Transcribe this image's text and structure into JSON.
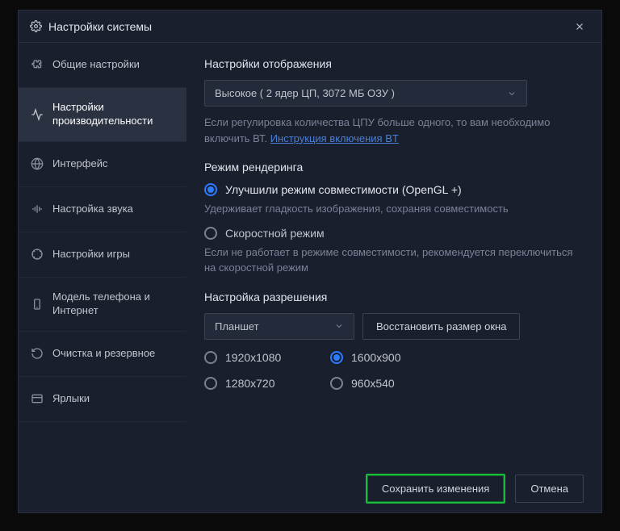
{
  "title": "Настройки системы",
  "sidebar": {
    "items": [
      {
        "label": "Общие настройки"
      },
      {
        "label": "Настройки производительности"
      },
      {
        "label": "Интерфейс"
      },
      {
        "label": "Настройка звука"
      },
      {
        "label": "Настройки игры"
      },
      {
        "label": "Модель телефона и Интернет"
      },
      {
        "label": "Очистка и резервное"
      },
      {
        "label": "Ярлыки"
      }
    ],
    "active_index": 1
  },
  "display_section": {
    "title": "Настройки отображения",
    "select_value": "Высокое ( 2 ядер ЦП, 3072 МБ ОЗУ )",
    "hint_prefix": "Если регулировка количества ЦПУ больше одного, то вам необходимо включить ВТ. ",
    "hint_link": "Инструкция включения ВT"
  },
  "render_section": {
    "title": "Режим рендеринга",
    "options": [
      {
        "label": "Улучшили режим совместимости (OpenGL +)",
        "desc": "Удерживает гладкость изображения, сохраняя совместимость",
        "checked": true
      },
      {
        "label": "Скоростной режим",
        "desc": "Если не работает в режиме совместимости, рекомендуется переключиться на скоростной режим",
        "checked": false
      }
    ]
  },
  "resolution_section": {
    "title": "Настройка разрешения",
    "select_value": "Планшет",
    "reset_button": "Восстановить размер окна",
    "options": [
      "1920x1080",
      "1600x900",
      "1280x720",
      "960x540"
    ],
    "checked_index": 1
  },
  "footer": {
    "save": "Сохранить изменения",
    "cancel": "Отмена"
  }
}
